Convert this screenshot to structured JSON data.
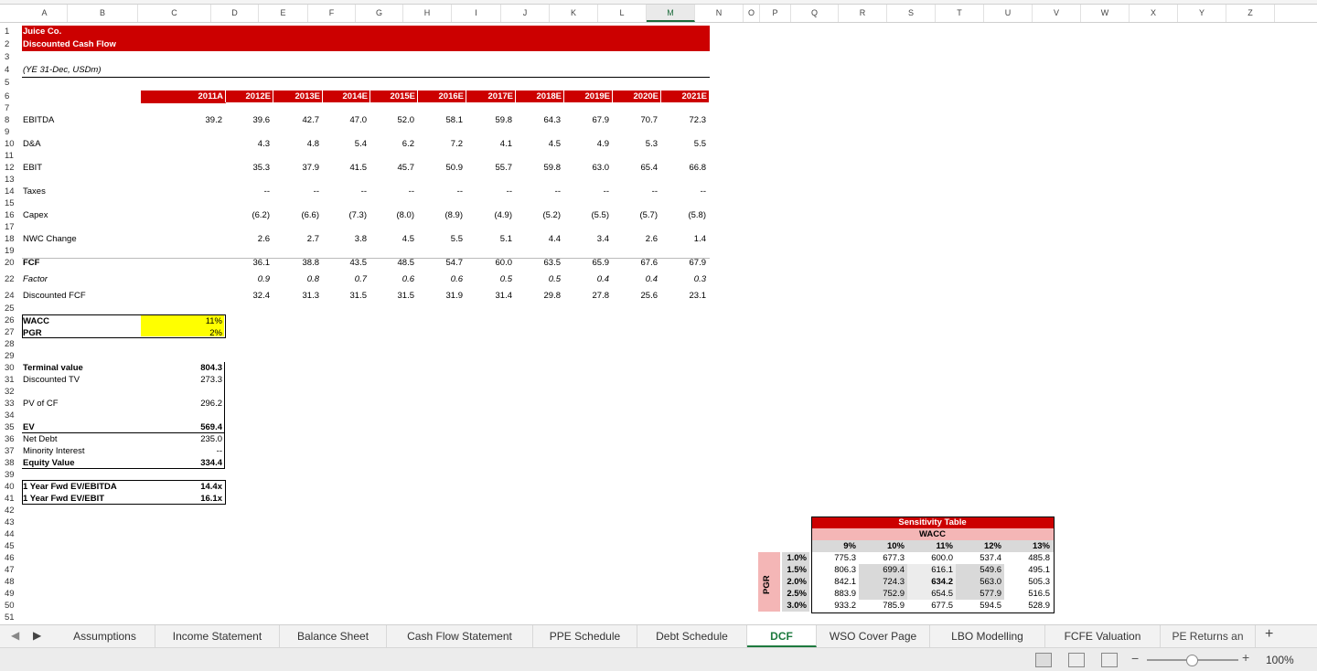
{
  "columns": [
    "A",
    "B",
    "C",
    "D",
    "E",
    "F",
    "G",
    "H",
    "I",
    "J",
    "K",
    "L",
    "M",
    "N",
    "O",
    "P",
    "Q",
    "R",
    "S",
    "T",
    "U",
    "V",
    "W",
    "X",
    "Y",
    "Z"
  ],
  "selected_column": "M",
  "rows": [
    "1",
    "2",
    "3",
    "4",
    "5",
    "6",
    "7",
    "8",
    "9",
    "10",
    "11",
    "12",
    "13",
    "14",
    "15",
    "16",
    "17",
    "18",
    "19",
    "20",
    "22",
    "24",
    "25",
    "26",
    "27",
    "28",
    "29",
    "30",
    "31",
    "32",
    "33",
    "34",
    "35",
    "36",
    "37",
    "38",
    "39",
    "40",
    "41",
    "42",
    "43",
    "44",
    "45",
    "46",
    "47",
    "48",
    "49",
    "50",
    "51"
  ],
  "company": "Juice Co.",
  "sheet_title": "Discounted Cash Flow",
  "units": "(YE 31-Dec, USDm)",
  "years": [
    "2011A",
    "2012E",
    "2013E",
    "2014E",
    "2015E",
    "2016E",
    "2017E",
    "2018E",
    "2019E",
    "2020E",
    "2021E"
  ],
  "table": [
    {
      "label": "EBITDA",
      "values": [
        "39.2",
        "39.6",
        "42.7",
        "47.0",
        "52.0",
        "58.1",
        "59.8",
        "64.3",
        "67.9",
        "70.7",
        "72.3"
      ]
    },
    {
      "label": "D&A",
      "values": [
        "",
        "4.3",
        "4.8",
        "5.4",
        "6.2",
        "7.2",
        "4.1",
        "4.5",
        "4.9",
        "5.3",
        "5.5"
      ]
    },
    {
      "label": "EBIT",
      "values": [
        "",
        "35.3",
        "37.9",
        "41.5",
        "45.7",
        "50.9",
        "55.7",
        "59.8",
        "63.0",
        "65.4",
        "66.8"
      ]
    },
    {
      "label": "Taxes",
      "values": [
        "",
        "--",
        "--",
        "--",
        "--",
        "--",
        "--",
        "--",
        "--",
        "--",
        "--"
      ]
    },
    {
      "label": "Capex",
      "values": [
        "",
        "(6.2)",
        "(6.6)",
        "(7.3)",
        "(8.0)",
        "(8.9)",
        "(4.9)",
        "(5.2)",
        "(5.5)",
        "(5.7)",
        "(5.8)"
      ]
    },
    {
      "label": "NWC Change",
      "values": [
        "",
        "2.6",
        "2.7",
        "3.8",
        "4.5",
        "5.5",
        "5.1",
        "4.4",
        "3.4",
        "2.6",
        "1.4"
      ]
    },
    {
      "label": "FCF",
      "values": [
        "",
        "36.1",
        "38.8",
        "43.5",
        "48.5",
        "54.7",
        "60.0",
        "63.5",
        "65.9",
        "67.6",
        "67.9"
      ]
    },
    {
      "label": "Factor",
      "values": [
        "",
        "0.9",
        "0.8",
        "0.7",
        "0.6",
        "0.6",
        "0.5",
        "0.5",
        "0.4",
        "0.4",
        "0.3"
      ]
    },
    {
      "label": "Discounted FCF",
      "values": [
        "",
        "32.4",
        "31.3",
        "31.5",
        "31.5",
        "31.9",
        "31.4",
        "29.8",
        "27.8",
        "25.6",
        "23.1"
      ]
    }
  ],
  "assumptions": [
    {
      "label": "WACC",
      "value": "11%"
    },
    {
      "label": "PGR",
      "value": "2%"
    }
  ],
  "valuation": [
    {
      "label": "Terminal value",
      "value": "804.3"
    },
    {
      "label": "Discounted TV",
      "value": "273.3"
    },
    {
      "label": "PV of CF",
      "value": "296.2"
    },
    {
      "label": "EV",
      "value": "569.4"
    },
    {
      "label": "Net Debt",
      "value": "235.0"
    },
    {
      "label": "Minority Interest",
      "value": "--"
    },
    {
      "label": "Equity Value",
      "value": "334.4"
    }
  ],
  "multiples": [
    {
      "label": "1 Year Fwd EV/EBITDA",
      "value": "14.4x"
    },
    {
      "label": "1 Year Fwd EV/EBIT",
      "value": "16.1x"
    }
  ],
  "sensitivity": {
    "title": "Sensitivity Table",
    "col_axis": "WACC",
    "row_axis": "PGR",
    "cols": [
      "9%",
      "10%",
      "11%",
      "12%",
      "13%"
    ],
    "rows": [
      "1.0%",
      "1.5%",
      "2.0%",
      "2.5%",
      "3.0%"
    ],
    "values": [
      [
        "775.3",
        "677.3",
        "600.0",
        "537.4",
        "485.8"
      ],
      [
        "806.3",
        "699.4",
        "616.1",
        "549.6",
        "495.1"
      ],
      [
        "842.1",
        "724.3",
        "634.2",
        "563.0",
        "505.3"
      ],
      [
        "883.9",
        "752.9",
        "654.5",
        "577.9",
        "516.5"
      ],
      [
        "933.2",
        "785.9",
        "677.5",
        "594.5",
        "528.9"
      ]
    ]
  },
  "tabs": [
    "Assumptions",
    "Income Statement",
    "Balance Sheet",
    "Cash Flow Statement",
    "PPE Schedule",
    "Debt Schedule",
    "DCF",
    "WSO Cover Page",
    "LBO Modelling",
    "FCFE Valuation",
    "PE Returns an"
  ],
  "active_tab": "DCF",
  "zoom": "100%",
  "colors": {
    "accent": "#cc0000",
    "highlight": "#ffff00",
    "excel_green": "#1d7a3e"
  }
}
